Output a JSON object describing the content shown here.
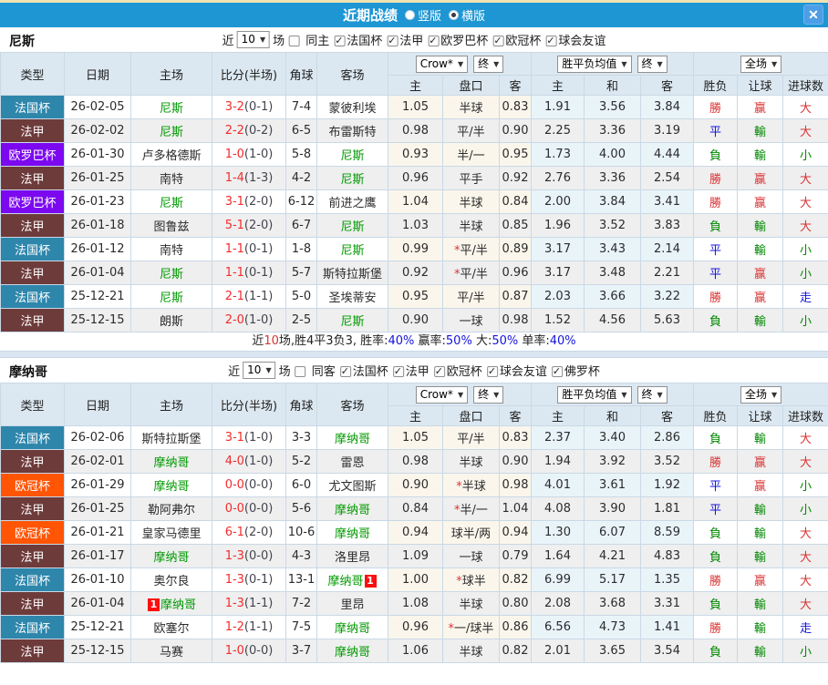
{
  "titlebar": {
    "title": "近期战绩",
    "vertical_label": "竖版",
    "horizontal_label": "横版",
    "close_glyph": "✕"
  },
  "columns": {
    "type": "类型",
    "date": "日期",
    "home": "主场",
    "score": "比分(半场)",
    "corner": "角球",
    "away": "客场",
    "sub": [
      "主",
      "盘口",
      "客",
      "主",
      "和",
      "客",
      "胜负",
      "让球",
      "进球数"
    ]
  },
  "controls": {
    "bookmaker": "Crow*",
    "final": "终",
    "avg": "胜平负均值",
    "final2": "终",
    "scope": "全场"
  },
  "palette": {
    "red": "#d93434",
    "blue": "#1414dd",
    "green": "#008800",
    "team": "#009900",
    "score": "#f22c2c",
    "half": "#44444f",
    "badge": "#fb0f0f"
  },
  "league_colors": {
    "法国杯": "#2e86ab",
    "法甲": "#6e3b3b",
    "欧罗巴杯": "#7c08f0",
    "欧冠杯": "#ff5505"
  },
  "sections": [
    {
      "team": "尼斯",
      "filter": {
        "near_label": "近",
        "count": "10",
        "unit_label": "场",
        "same_label": "同主",
        "same_checked": false,
        "leagues": [
          "法国杯",
          "法甲",
          "欧罗巴杯",
          "欧冠杯",
          "球会友谊"
        ]
      },
      "rows": [
        {
          "lg": "法国杯",
          "date": "26-02-05",
          "h": "尼斯",
          "hT": 1,
          "sc": "3-2",
          "hf": "(0-1)",
          "cn": "7-4",
          "a": "蒙彼利埃",
          "aT": 0,
          "o1": "1.05",
          "hc": "半球",
          "st": 0,
          "o2": "0.83",
          "m1": "1.91",
          "m2": "3.56",
          "m3": "3.84",
          "r": "勝",
          "rc": "red",
          "l": "赢",
          "lc": "red",
          "g": "大",
          "gc": "red"
        },
        {
          "lg": "法甲",
          "date": "26-02-02",
          "h": "尼斯",
          "hT": 1,
          "sc": "2-2",
          "hf": "(0-2)",
          "cn": "6-5",
          "a": "布雷斯特",
          "aT": 0,
          "o1": "0.98",
          "hc": "平/半",
          "st": 0,
          "o2": "0.90",
          "m1": "2.25",
          "m2": "3.36",
          "m3": "3.19",
          "r": "平",
          "rc": "blue",
          "l": "輸",
          "lc": "green",
          "g": "大",
          "gc": "red"
        },
        {
          "lg": "欧罗巴杯",
          "date": "26-01-30",
          "h": "卢多格德斯",
          "hT": 0,
          "sc": "1-0",
          "hf": "(1-0)",
          "cn": "5-8",
          "a": "尼斯",
          "aT": 1,
          "o1": "0.93",
          "hc": "半/一",
          "st": 0,
          "o2": "0.95",
          "m1": "1.73",
          "m2": "4.00",
          "m3": "4.44",
          "r": "負",
          "rc": "green",
          "l": "輸",
          "lc": "green",
          "g": "小",
          "gc": "green"
        },
        {
          "lg": "法甲",
          "date": "26-01-25",
          "h": "南特",
          "hT": 0,
          "sc": "1-4",
          "hf": "(1-3)",
          "cn": "4-2",
          "a": "尼斯",
          "aT": 1,
          "o1": "0.96",
          "hc": "平手",
          "st": 0,
          "o2": "0.92",
          "m1": "2.76",
          "m2": "3.36",
          "m3": "2.54",
          "r": "勝",
          "rc": "red",
          "l": "赢",
          "lc": "red",
          "g": "大",
          "gc": "red"
        },
        {
          "lg": "欧罗巴杯",
          "date": "26-01-23",
          "h": "尼斯",
          "hT": 1,
          "sc": "3-1",
          "hf": "(2-0)",
          "cn": "6-12",
          "a": "前进之鹰",
          "aT": 0,
          "o1": "1.04",
          "hc": "半球",
          "st": 0,
          "o2": "0.84",
          "m1": "2.00",
          "m2": "3.84",
          "m3": "3.41",
          "r": "勝",
          "rc": "red",
          "l": "赢",
          "lc": "red",
          "g": "大",
          "gc": "red"
        },
        {
          "lg": "法甲",
          "date": "26-01-18",
          "h": "图鲁兹",
          "hT": 0,
          "sc": "5-1",
          "hf": "(2-0)",
          "cn": "6-7",
          "a": "尼斯",
          "aT": 1,
          "o1": "1.03",
          "hc": "半球",
          "st": 0,
          "o2": "0.85",
          "m1": "1.96",
          "m2": "3.52",
          "m3": "3.83",
          "r": "負",
          "rc": "green",
          "l": "輸",
          "lc": "green",
          "g": "大",
          "gc": "red"
        },
        {
          "lg": "法国杯",
          "date": "26-01-12",
          "h": "南特",
          "hT": 0,
          "sc": "1-1",
          "hf": "(0-1)",
          "cn": "1-8",
          "a": "尼斯",
          "aT": 1,
          "o1": "0.99",
          "hc": "平/半",
          "st": 1,
          "o2": "0.89",
          "m1": "3.17",
          "m2": "3.43",
          "m3": "2.14",
          "r": "平",
          "rc": "blue",
          "l": "輸",
          "lc": "green",
          "g": "小",
          "gc": "green"
        },
        {
          "lg": "法甲",
          "date": "26-01-04",
          "h": "尼斯",
          "hT": 1,
          "sc": "1-1",
          "hf": "(0-1)",
          "cn": "5-7",
          "a": "斯特拉斯堡",
          "aT": 0,
          "o1": "0.92",
          "hc": "平/半",
          "st": 1,
          "o2": "0.96",
          "m1": "3.17",
          "m2": "3.48",
          "m3": "2.21",
          "r": "平",
          "rc": "blue",
          "l": "赢",
          "lc": "red",
          "g": "小",
          "gc": "green"
        },
        {
          "lg": "法国杯",
          "date": "25-12-21",
          "h": "尼斯",
          "hT": 1,
          "sc": "2-1",
          "hf": "(1-1)",
          "cn": "5-0",
          "a": "圣埃蒂安",
          "aT": 0,
          "o1": "0.95",
          "hc": "平/半",
          "st": 0,
          "o2": "0.87",
          "m1": "2.03",
          "m2": "3.66",
          "m3": "3.22",
          "r": "勝",
          "rc": "red",
          "l": "赢",
          "lc": "red",
          "g": "走",
          "gc": "blue"
        },
        {
          "lg": "法甲",
          "date": "25-12-15",
          "h": "朗斯",
          "hT": 0,
          "sc": "2-0",
          "hf": "(1-0)",
          "cn": "2-5",
          "a": "尼斯",
          "aT": 1,
          "o1": "0.90",
          "hc": "一球",
          "st": 0,
          "o2": "0.98",
          "m1": "1.52",
          "m2": "4.56",
          "m3": "5.63",
          "r": "負",
          "rc": "green",
          "l": "輸",
          "lc": "green",
          "g": "小",
          "gc": "green"
        }
      ],
      "summary": [
        {
          "t": "近"
        },
        {
          "t": "10",
          "c": "red"
        },
        {
          "t": "场,胜4平3负3, 胜率:"
        },
        {
          "t": "40%",
          "c": "blue"
        },
        {
          "t": " 赢率:"
        },
        {
          "t": "50%",
          "c": "blue"
        },
        {
          "t": " 大:"
        },
        {
          "t": "50%",
          "c": "blue"
        },
        {
          "t": " 单率:"
        },
        {
          "t": "40%",
          "c": "blue"
        }
      ]
    },
    {
      "team": "摩纳哥",
      "filter": {
        "near_label": "近",
        "count": "10",
        "unit_label": "场",
        "same_label": "同客",
        "same_checked": false,
        "leagues": [
          "法国杯",
          "法甲",
          "欧冠杯",
          "球会友谊",
          "佛罗杯"
        ]
      },
      "rows": [
        {
          "lg": "法国杯",
          "date": "26-02-06",
          "h": "斯特拉斯堡",
          "hT": 0,
          "sc": "3-1",
          "hf": "(1-0)",
          "cn": "3-3",
          "a": "摩纳哥",
          "aT": 1,
          "o1": "1.05",
          "hc": "平/半",
          "st": 0,
          "o2": "0.83",
          "m1": "2.37",
          "m2": "3.40",
          "m3": "2.86",
          "r": "負",
          "rc": "green",
          "l": "輸",
          "lc": "green",
          "g": "大",
          "gc": "red"
        },
        {
          "lg": "法甲",
          "date": "26-02-01",
          "h": "摩纳哥",
          "hT": 1,
          "sc": "4-0",
          "hf": "(1-0)",
          "cn": "5-2",
          "a": "雷恩",
          "aT": 0,
          "o1": "0.98",
          "hc": "半球",
          "st": 0,
          "o2": "0.90",
          "m1": "1.94",
          "m2": "3.92",
          "m3": "3.52",
          "r": "勝",
          "rc": "red",
          "l": "赢",
          "lc": "red",
          "g": "大",
          "gc": "red"
        },
        {
          "lg": "欧冠杯",
          "date": "26-01-29",
          "h": "摩纳哥",
          "hT": 1,
          "sc": "0-0",
          "hf": "(0-0)",
          "cn": "6-0",
          "a": "尤文图斯",
          "aT": 0,
          "o1": "0.90",
          "hc": "半球",
          "st": 1,
          "o2": "0.98",
          "m1": "4.01",
          "m2": "3.61",
          "m3": "1.92",
          "r": "平",
          "rc": "blue",
          "l": "赢",
          "lc": "red",
          "g": "小",
          "gc": "green"
        },
        {
          "lg": "法甲",
          "date": "26-01-25",
          "h": "勒阿弗尔",
          "hT": 0,
          "sc": "0-0",
          "hf": "(0-0)",
          "cn": "5-6",
          "a": "摩纳哥",
          "aT": 1,
          "o1": "0.84",
          "hc": "半/一",
          "st": 1,
          "o2": "1.04",
          "m1": "4.08",
          "m2": "3.90",
          "m3": "1.81",
          "r": "平",
          "rc": "blue",
          "l": "輸",
          "lc": "green",
          "g": "小",
          "gc": "green"
        },
        {
          "lg": "欧冠杯",
          "date": "26-01-21",
          "h": "皇家马德里",
          "hT": 0,
          "sc": "6-1",
          "hf": "(2-0)",
          "cn": "10-6",
          "a": "摩纳哥",
          "aT": 1,
          "o1": "0.94",
          "hc": "球半/两",
          "st": 0,
          "o2": "0.94",
          "m1": "1.30",
          "m2": "6.07",
          "m3": "8.59",
          "r": "負",
          "rc": "green",
          "l": "輸",
          "lc": "green",
          "g": "大",
          "gc": "red"
        },
        {
          "lg": "法甲",
          "date": "26-01-17",
          "h": "摩纳哥",
          "hT": 1,
          "sc": "1-3",
          "hf": "(0-0)",
          "cn": "4-3",
          "a": "洛里昂",
          "aT": 0,
          "o1": "1.09",
          "hc": "一球",
          "st": 0,
          "o2": "0.79",
          "m1": "1.64",
          "m2": "4.21",
          "m3": "4.83",
          "r": "負",
          "rc": "green",
          "l": "輸",
          "lc": "green",
          "g": "大",
          "gc": "red"
        },
        {
          "lg": "法国杯",
          "date": "26-01-10",
          "h": "奥尔良",
          "hT": 0,
          "sc": "1-3",
          "hf": "(0-1)",
          "cn": "13-1",
          "a": "摩纳哥",
          "aT": 1,
          "aB": {
            "t": "1",
            "pos": "after"
          },
          "o1": "1.00",
          "hc": "球半",
          "st": 1,
          "o2": "0.82",
          "m1": "6.99",
          "m2": "5.17",
          "m3": "1.35",
          "r": "勝",
          "rc": "red",
          "l": "赢",
          "lc": "red",
          "g": "大",
          "gc": "red"
        },
        {
          "lg": "法甲",
          "date": "26-01-04",
          "h": "摩纳哥",
          "hT": 1,
          "hB": {
            "t": "1",
            "pos": "before"
          },
          "sc": "1-3",
          "hf": "(1-1)",
          "cn": "7-2",
          "a": "里昂",
          "aT": 0,
          "o1": "1.08",
          "hc": "半球",
          "st": 0,
          "o2": "0.80",
          "m1": "2.08",
          "m2": "3.68",
          "m3": "3.31",
          "r": "負",
          "rc": "green",
          "l": "輸",
          "lc": "green",
          "g": "大",
          "gc": "red"
        },
        {
          "lg": "法国杯",
          "date": "25-12-21",
          "h": "欧塞尔",
          "hT": 0,
          "sc": "1-2",
          "hf": "(1-1)",
          "cn": "7-5",
          "a": "摩纳哥",
          "aT": 1,
          "o1": "0.96",
          "hc": "一/球半",
          "st": 1,
          "o2": "0.86",
          "m1": "6.56",
          "m2": "4.73",
          "m3": "1.41",
          "r": "勝",
          "rc": "red",
          "l": "輸",
          "lc": "green",
          "g": "走",
          "gc": "blue"
        },
        {
          "lg": "法甲",
          "date": "25-12-15",
          "h": "马赛",
          "hT": 0,
          "sc": "1-0",
          "hf": "(0-0)",
          "cn": "3-7",
          "a": "摩纳哥",
          "aT": 1,
          "o1": "1.06",
          "hc": "半球",
          "st": 0,
          "o2": "0.82",
          "m1": "2.01",
          "m2": "3.65",
          "m3": "3.54",
          "r": "負",
          "rc": "green",
          "l": "輸",
          "lc": "green",
          "g": "小",
          "gc": "green"
        }
      ],
      "summary": null
    }
  ]
}
